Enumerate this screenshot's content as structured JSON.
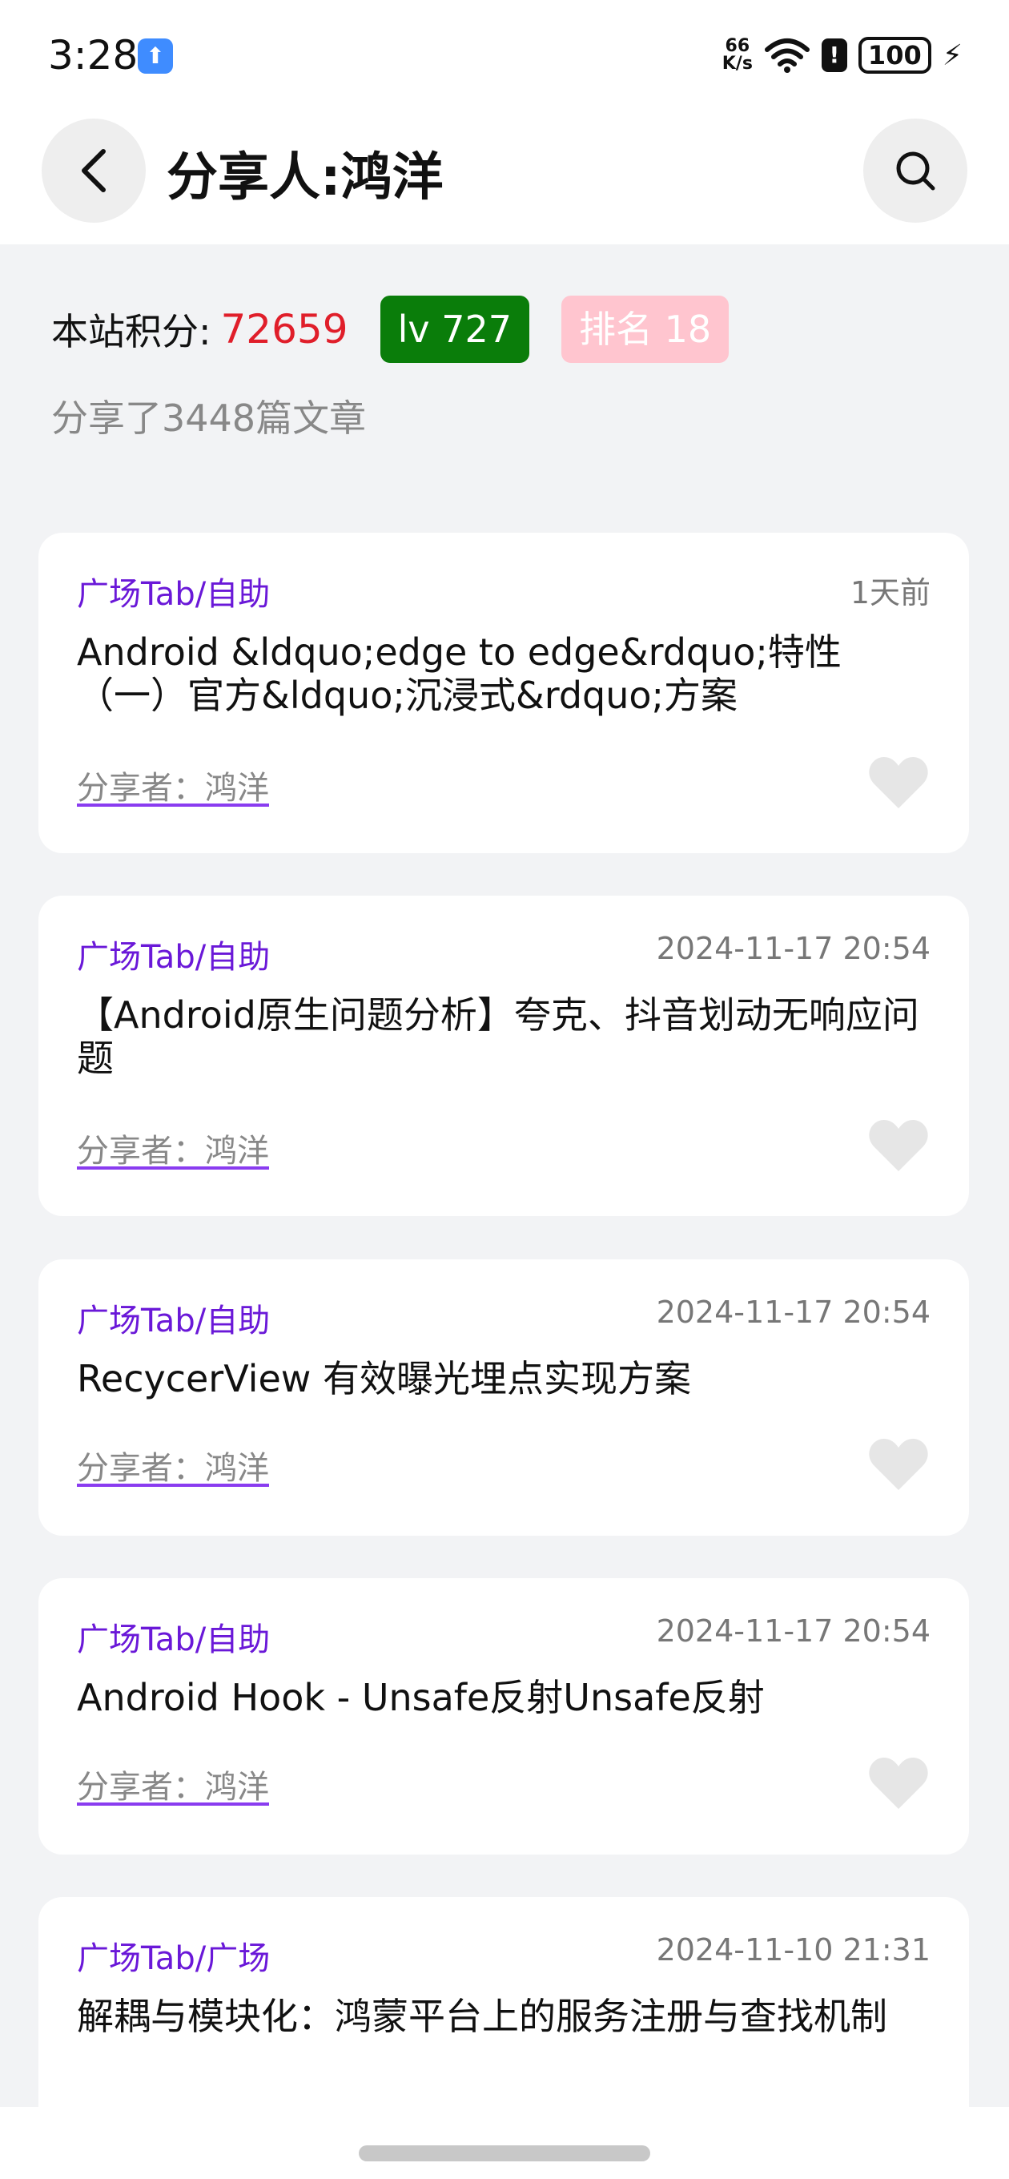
{
  "status_bar": {
    "time": "3:28",
    "net_speed_value": "66",
    "net_speed_unit": "K/s",
    "battery": "100"
  },
  "header": {
    "title": "分享人:鸿洋"
  },
  "profile": {
    "score_label": "本站积分:",
    "score_value": "72659",
    "level": "lv 727",
    "rank": "排名 18",
    "share_count": "分享了3448篇文章"
  },
  "articles": [
    {
      "category": "广场Tab/自助",
      "date": "1天前",
      "title": "Android &ldquo;edge to edge&rdquo;特性（一）官方&ldquo;沉浸式&rdquo;方案",
      "sharer": "分享者：鸿洋"
    },
    {
      "category": "广场Tab/自助",
      "date": "2024-11-17 20:54",
      "title": "【Android原生问题分析】夸克、抖音划动无响应问题",
      "sharer": "分享者：鸿洋"
    },
    {
      "category": "广场Tab/自助",
      "date": "2024-11-17 20:54",
      "title": "RecycerView 有效曝光埋点实现方案",
      "sharer": "分享者：鸿洋"
    },
    {
      "category": "广场Tab/自助",
      "date": "2024-11-17 20:54",
      "title": "Android Hook - Unsafe反射Unsafe反射",
      "sharer": "分享者：鸿洋"
    },
    {
      "category": "广场Tab/广场",
      "date": "2024-11-10 21:31",
      "title": "解耦与模块化：鸿蒙平台上的服务注册与查找机制",
      "sharer": ""
    }
  ],
  "colors": {
    "accent_purple": "#6a18d8",
    "score_red": "#e01e2a",
    "level_green": "#0a7d0a",
    "rank_pink": "#ffc5cf"
  },
  "icons": [
    "back-icon",
    "search-icon",
    "heart-icon",
    "wifi-icon",
    "battery-icon",
    "charging-icon"
  ]
}
